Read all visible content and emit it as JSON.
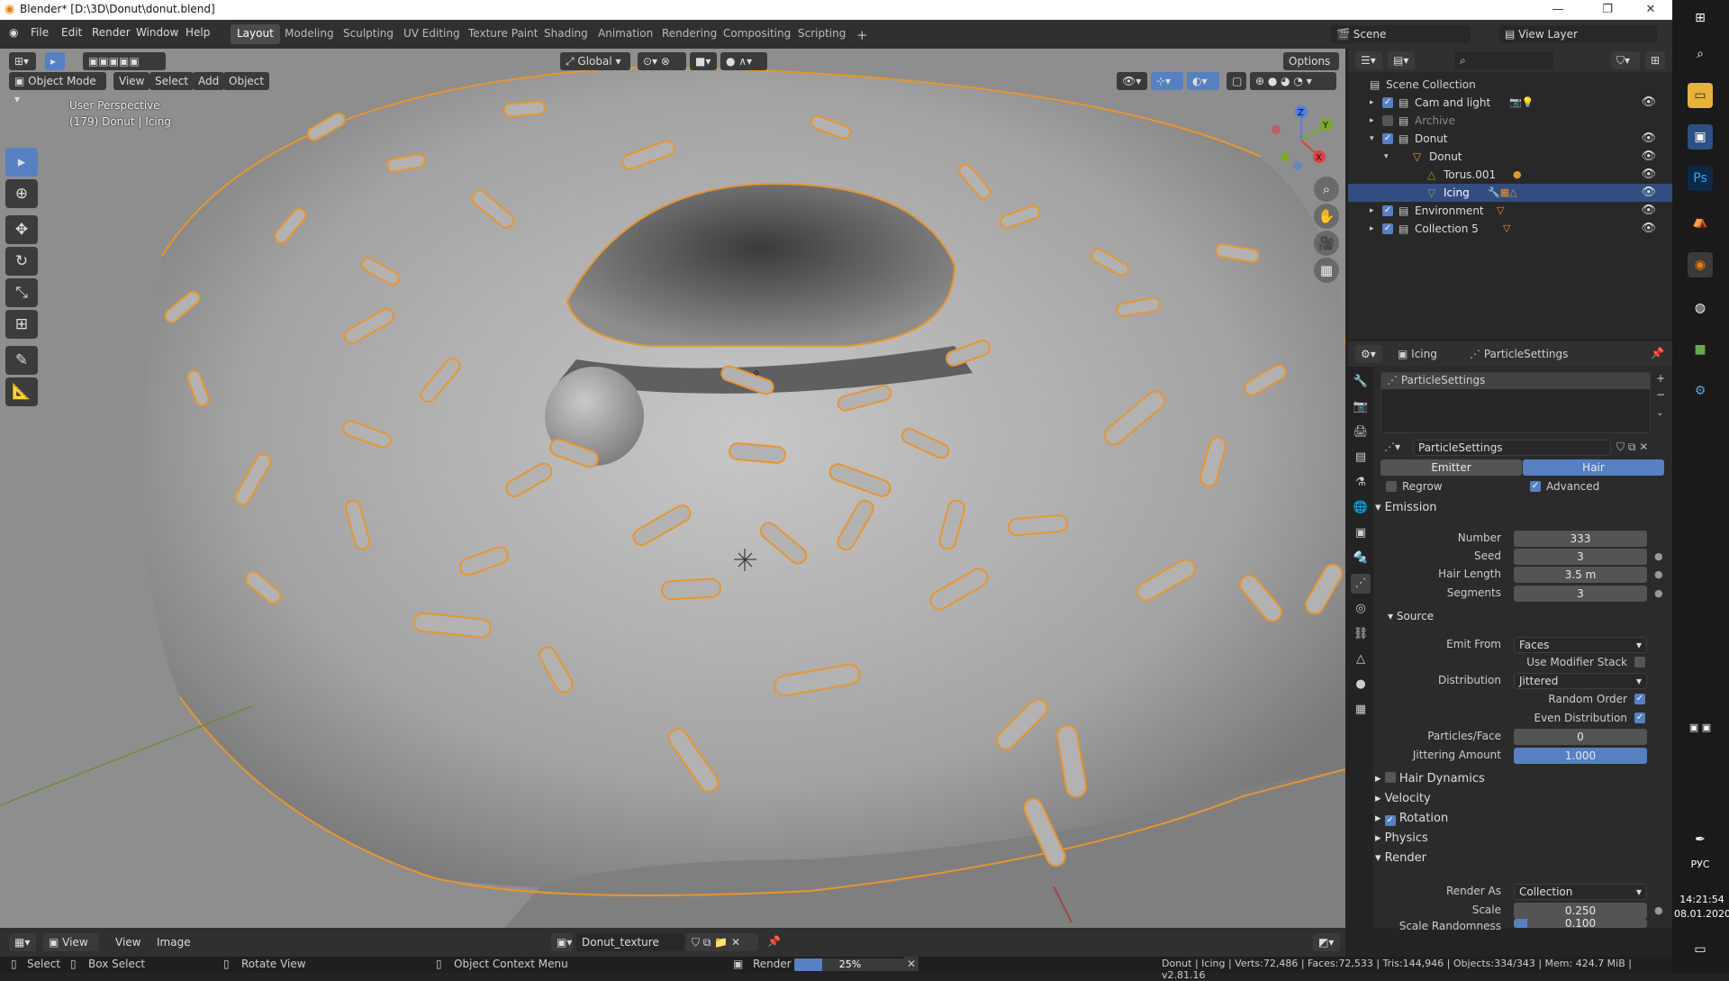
{
  "window": {
    "title": "Blender* [D:\\3D\\Donut\\donut.blend]",
    "minimize": "—",
    "maximize": "❐",
    "close": "✕"
  },
  "menu": [
    "File",
    "Edit",
    "Render",
    "Window",
    "Help"
  ],
  "workspaces": [
    "Layout",
    "Modeling",
    "Sculpting",
    "UV Editing",
    "Texture Paint",
    "Shading",
    "Animation",
    "Rendering",
    "Compositing",
    "Scripting"
  ],
  "scene": {
    "name": "Scene",
    "view_layer": "View Layer"
  },
  "viewport": {
    "mode": "Object Mode",
    "menus": [
      "View",
      "Select",
      "Add",
      "Object"
    ],
    "transform": "Global",
    "options": "Options",
    "perspective": "User Perspective",
    "context": "(179) Donut | Icing"
  },
  "outliner": {
    "root": "Scene Collection",
    "rows": [
      {
        "label": "Cam and light",
        "checked": true,
        "indent": 0
      },
      {
        "label": "Archive",
        "checked": false,
        "indent": 0
      },
      {
        "label": "Donut",
        "checked": true,
        "indent": 0
      },
      {
        "label": "Donut",
        "checked": null,
        "indent": 1
      },
      {
        "label": "Torus.001",
        "checked": null,
        "indent": 2
      },
      {
        "label": "Icing",
        "checked": null,
        "indent": 2,
        "selected": true
      },
      {
        "label": "Environment",
        "checked": true,
        "indent": 0
      },
      {
        "label": "Collection 5",
        "checked": true,
        "indent": 0
      }
    ]
  },
  "properties": {
    "object": "Icing",
    "settings": "ParticleSettings",
    "slot": "ParticleSettings",
    "datablock": "ParticleSettings",
    "type_emitter": "Emitter",
    "type_hair": "Hair",
    "regrow": "Regrow",
    "advanced": "Advanced",
    "emission": {
      "title": "Emission",
      "number_label": "Number",
      "number": "333",
      "seed_label": "Seed",
      "seed": "3",
      "hair_length_label": "Hair Length",
      "hair_length": "3.5 m",
      "segments_label": "Segments",
      "segments": "3"
    },
    "source": {
      "title": "Source",
      "emit_from_label": "Emit From",
      "emit_from": "Faces",
      "use_modifier_stack": "Use Modifier Stack",
      "distribution_label": "Distribution",
      "distribution": "Jittered",
      "random_order": "Random Order",
      "even_distribution": "Even Distribution",
      "particles_face_label": "Particles/Face",
      "particles_face": "0",
      "jittering_label": "Jittering Amount",
      "jittering": "1.000",
      "jittering_fraction": 1.0
    },
    "panels": [
      "Hair Dynamics",
      "Velocity",
      "Rotation",
      "Physics"
    ],
    "render": {
      "title": "Render",
      "render_as_label": "Render As",
      "render_as": "Collection",
      "scale_label": "Scale",
      "scale": "0.250",
      "scale_rand_label": "Scale Randomness",
      "scale_rand": "0.100",
      "scale_rand_fraction": 0.1
    }
  },
  "image_editor": {
    "menus": [
      "View",
      "View",
      "Image"
    ],
    "image": "Donut_texture"
  },
  "status": {
    "select": "Select",
    "box_select": "Box Select",
    "rotate_view": "Rotate View",
    "context_menu": "Object Context Menu",
    "render": "Render",
    "render_progress": "25%",
    "render_fraction": 0.25,
    "stats": "Donut | Icing | Verts:72,486 | Faces:72,533 | Tris:144,946 | Objects:334/343 | Mem: 424.7 MiB | v2.81.16"
  },
  "taskbar": {
    "time": "14:21:54",
    "date": "08.01.2020",
    "lang": "РУС"
  },
  "colors": {
    "accent": "#5680c2",
    "selection_outline": "#e8952f",
    "header": "#303030",
    "panel": "#2b2b2b"
  }
}
